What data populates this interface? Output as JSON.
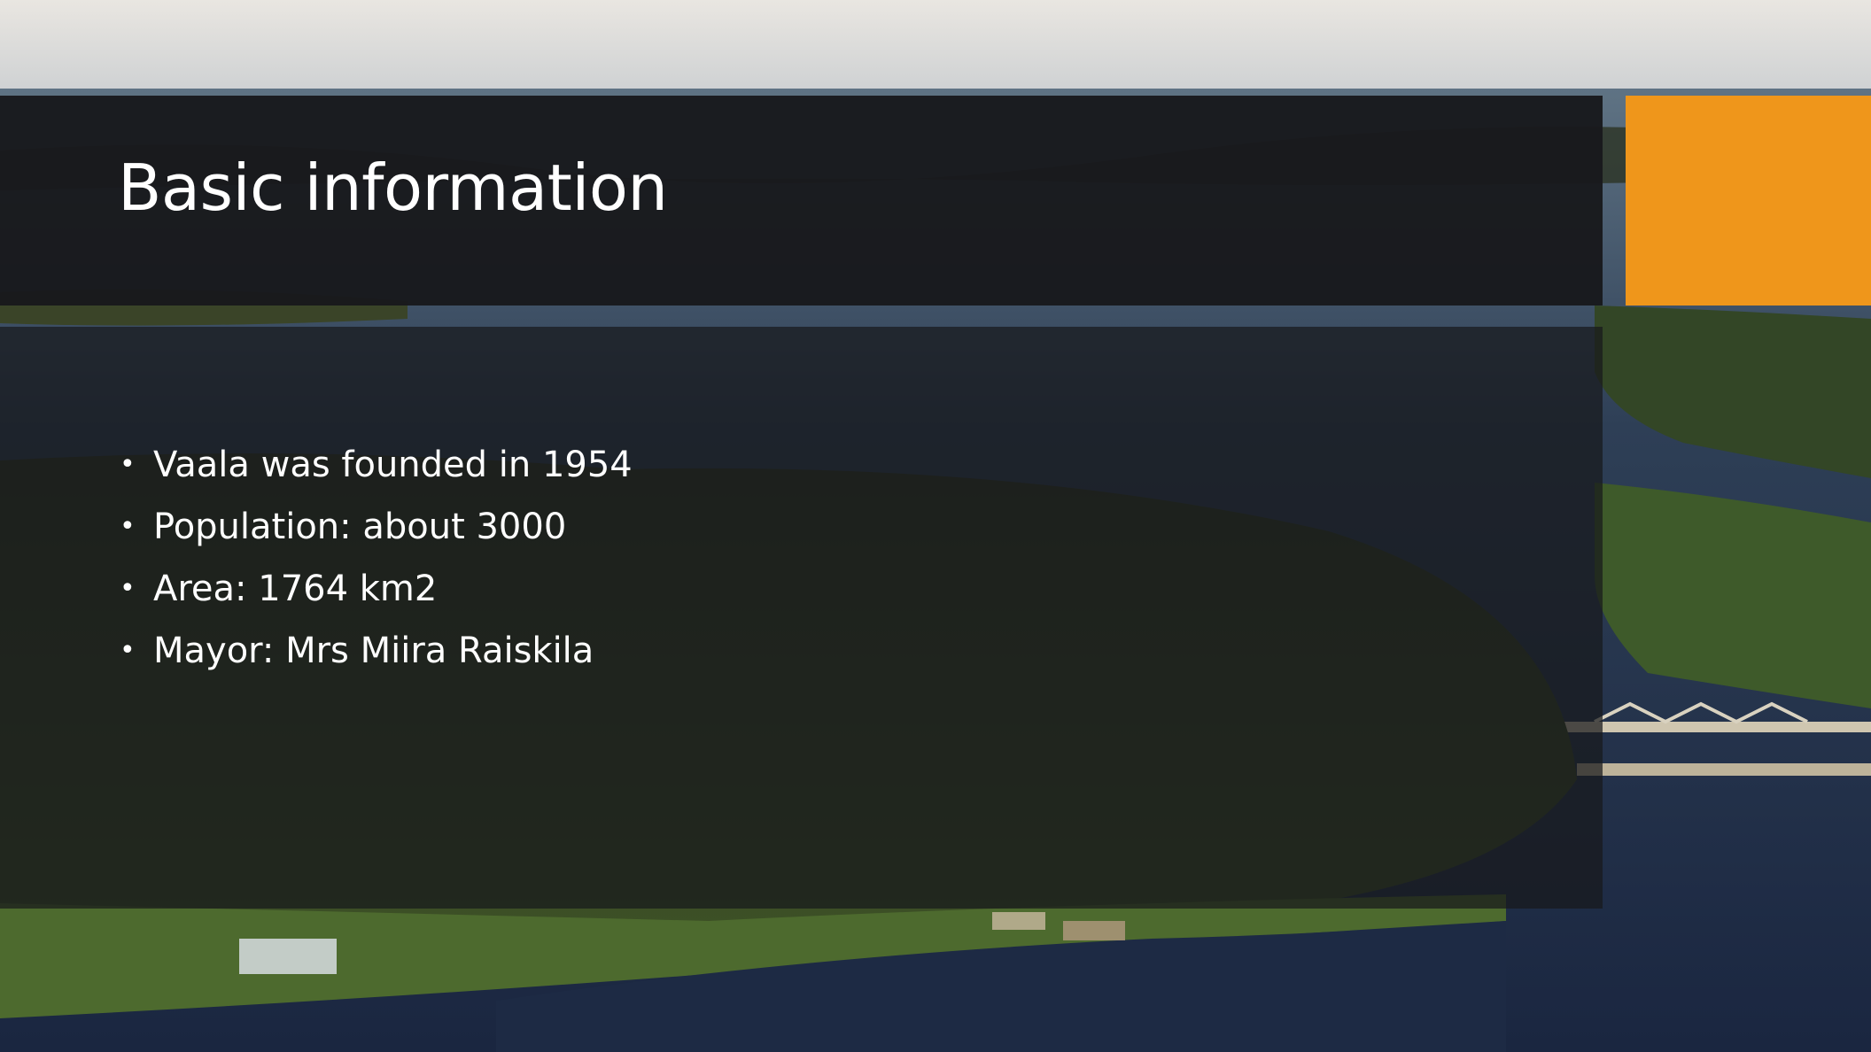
{
  "slide": {
    "title": "Basic information",
    "bullets": [
      "Vaala was founded in 1954",
      "Population: about 3000",
      "Area: 1764 km2",
      "Mayor: Mrs Miira Raiskila"
    ],
    "bullet_glyph": "•"
  },
  "colors": {
    "accent": "#ef961b",
    "title_band": "#18191c",
    "text": "#ffffff"
  },
  "background_image": "aerial-lake-landscape"
}
